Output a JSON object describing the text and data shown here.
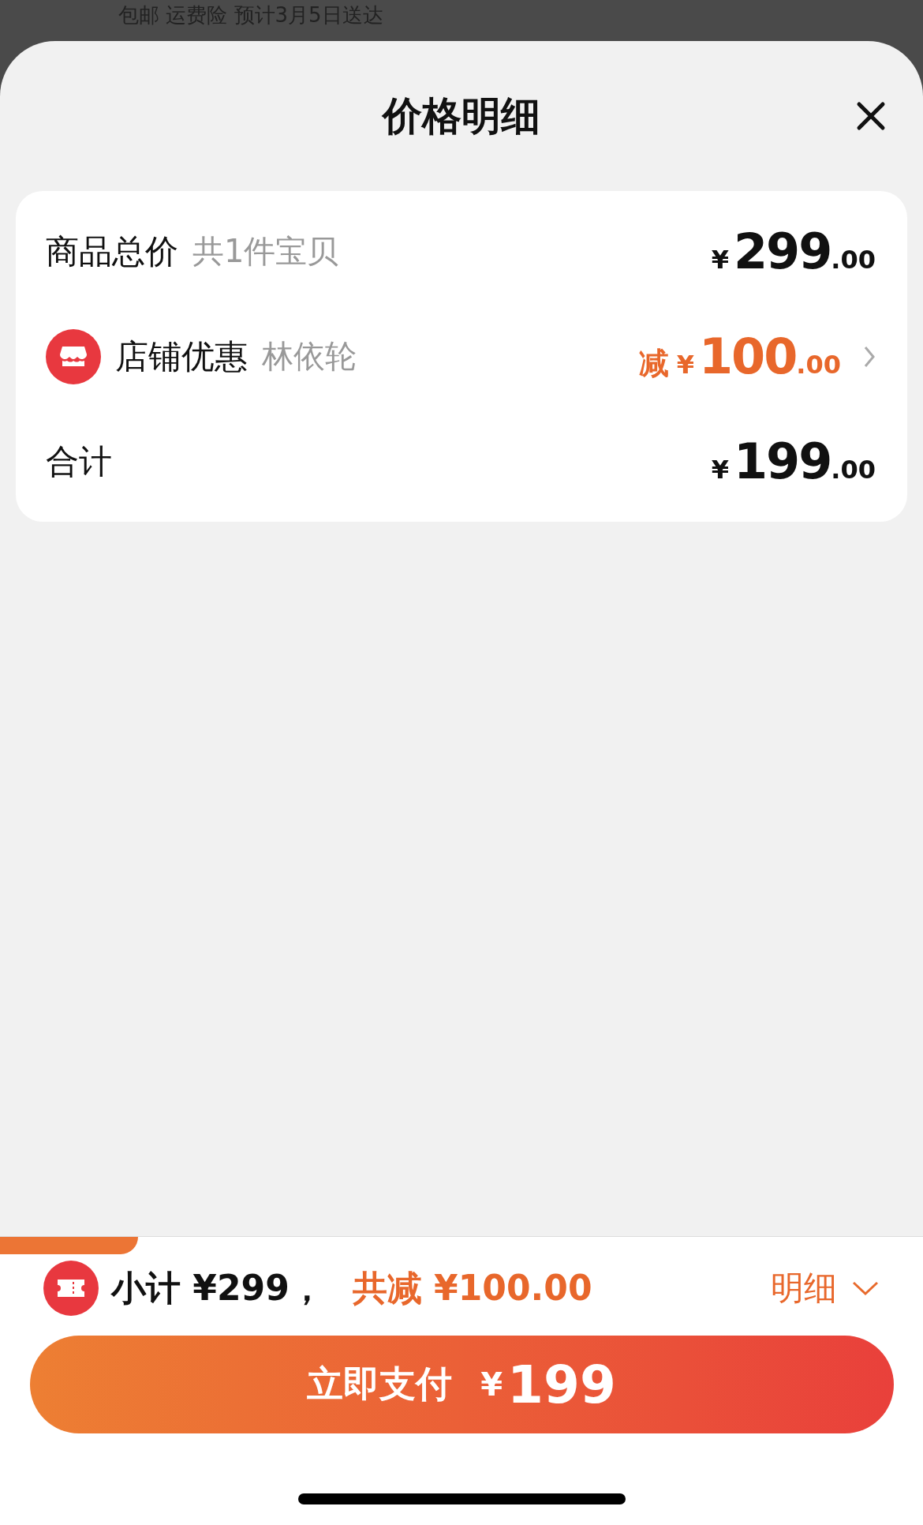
{
  "background_text": "包邮 运费险 预计3月5日送达",
  "sheet": {
    "title": "价格明细"
  },
  "rows": [
    {
      "kind": "plain",
      "label": "商品总价",
      "note": "共1件宝贝",
      "prefix": "",
      "currency": "¥",
      "integer": "299",
      "decimal": ".00",
      "chevron": false
    },
    {
      "kind": "discount",
      "label": "店铺优惠",
      "note": "林依轮",
      "prefix": "减",
      "currency": "¥",
      "integer": "100",
      "decimal": ".00",
      "chevron": true
    },
    {
      "kind": "plain",
      "label": "合计",
      "note": "",
      "prefix": "",
      "currency": "¥",
      "integer": "199",
      "decimal": ".00",
      "chevron": false
    }
  ],
  "summary": {
    "subtotal": "小计 ¥299，",
    "discount": "共减 ¥100.00",
    "details": "明细"
  },
  "pay_button": {
    "label": "立即支付",
    "currency": "¥",
    "amount": "199"
  }
}
